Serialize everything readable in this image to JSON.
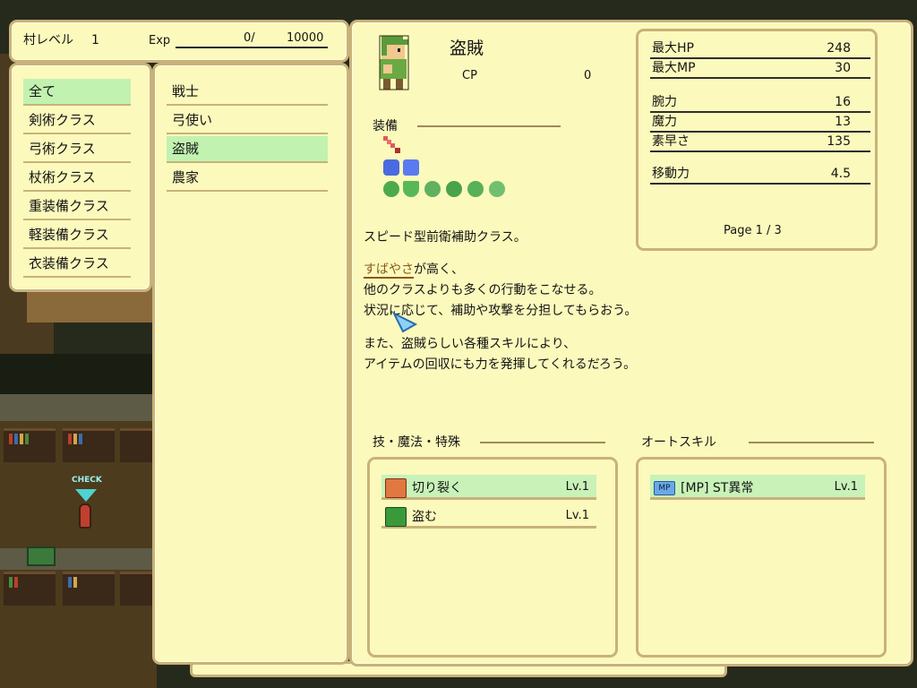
{
  "village": {
    "level_label": "村レベル",
    "level_value": "1",
    "exp_label": "Exp",
    "exp_value": "0/",
    "exp_max": "10000"
  },
  "categories": [
    {
      "label": "全て",
      "selected": true
    },
    {
      "label": "剣術クラス",
      "selected": false
    },
    {
      "label": "弓術クラス",
      "selected": false
    },
    {
      "label": "杖術クラス",
      "selected": false
    },
    {
      "label": "重装備クラス",
      "selected": false
    },
    {
      "label": "軽装備クラス",
      "selected": false
    },
    {
      "label": "衣装備クラス",
      "selected": false
    }
  ],
  "classes": [
    {
      "label": "戦士",
      "selected": false
    },
    {
      "label": "弓使い",
      "selected": false
    },
    {
      "label": "盗賊",
      "selected": true
    },
    {
      "label": "農家",
      "selected": false
    }
  ],
  "detail": {
    "class_name": "盗賊",
    "cp_label": "CP",
    "cp_value": "0",
    "equip_label": "装備",
    "description_title": "スピード型前衛補助クラス。",
    "description_highlight": "すばやさ",
    "description_lines": [
      "が高く、",
      "他のクラスよりも多くの行動をこなせる。",
      "状況に応じて、補助や攻撃を分担してもらおう。",
      "また、盗賊らしい各種スキルにより、",
      "アイテムの回収にも力を発揮してくれるだろう。"
    ]
  },
  "stats": {
    "hp_label": "最大HP",
    "hp_value": "248",
    "mp_label": "最大MP",
    "mp_value": "30",
    "str_label": "腕力",
    "str_value": "16",
    "mag_label": "魔力",
    "mag_value": "13",
    "spd_label": "素早さ",
    "spd_value": "135",
    "mov_label": "移動力",
    "mov_value": "4.5",
    "page_text": "Page 1 / 3"
  },
  "skills": {
    "title": "技・魔法・特殊",
    "items": [
      {
        "name": "切り裂く",
        "level": "Lv.1",
        "icon": "slash-icon"
      },
      {
        "name": "盗む",
        "level": "Lv.1",
        "icon": "steal-icon"
      }
    ]
  },
  "auto_skills": {
    "title": "オートスキル",
    "items": [
      {
        "badge": "MP",
        "name": "[MP] ST異常",
        "level": "Lv.1",
        "icon": "mp-icon"
      }
    ]
  },
  "map": {
    "check_label": "CHECK"
  },
  "colors": {
    "panel_bg": "#fbf9bc",
    "panel_border": "#c8b27a",
    "selected_bg": "#c2f2b0"
  }
}
